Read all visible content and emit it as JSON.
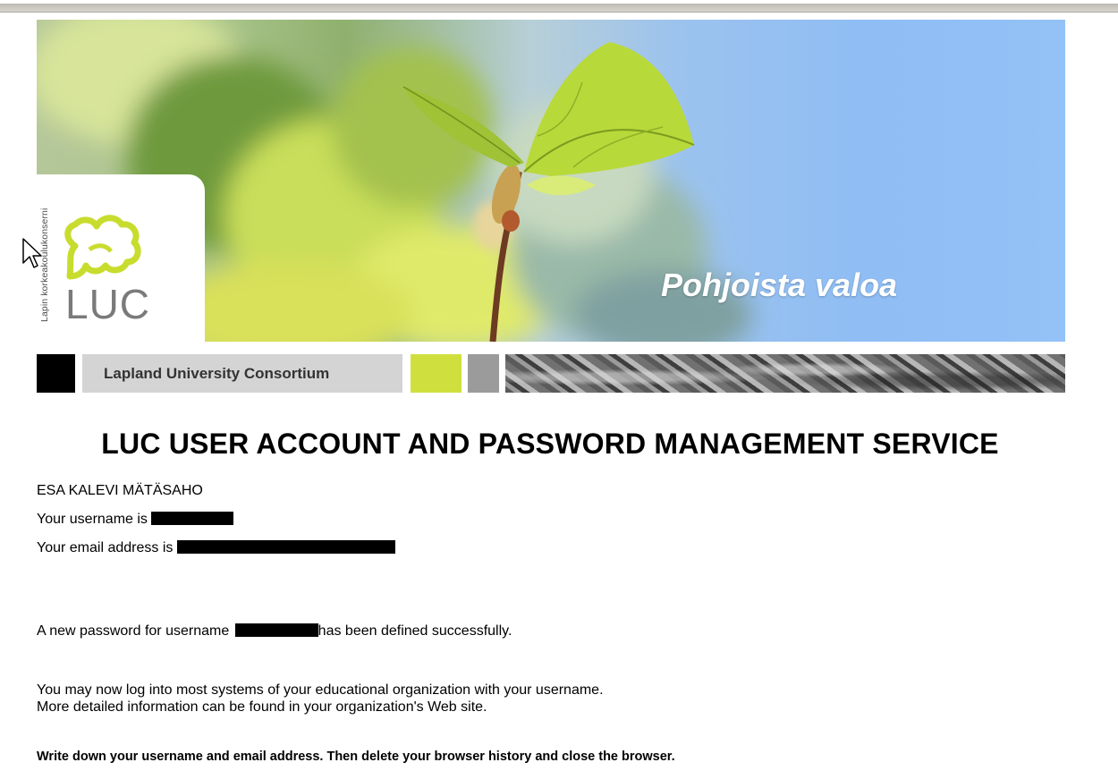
{
  "header": {
    "slogan": "Pohjoista valoa",
    "logo_vertical_text": "Lapin korkeakoulukonserni",
    "logo_wordmark": "LUC",
    "consortium_name": "Lapland University Consortium"
  },
  "page_title": "LUC USER ACCOUNT AND PASSWORD MANAGEMENT SERVICE",
  "user": {
    "full_name": "ESA KALEVI MÄTÄSAHO",
    "username_prefix": "Your username is",
    "email_prefix": "Your email address is"
  },
  "messages": {
    "success_prefix": "A new password for username",
    "success_suffix": "has been defined successfully.",
    "info_line1": "You may now log into most systems of your educational organization with your username.",
    "info_line2": "More detailed information can be found in your organization's Web site.",
    "instruction": "Write down your username and email address. Then delete your browser history and close the browser."
  },
  "colors": {
    "accent_green": "#cfe03e",
    "consortium_bar": "#d4d4d4",
    "redaction": "#000000"
  },
  "icons": [
    "mouse-cursor-icon",
    "luc-leaf-icon"
  ]
}
